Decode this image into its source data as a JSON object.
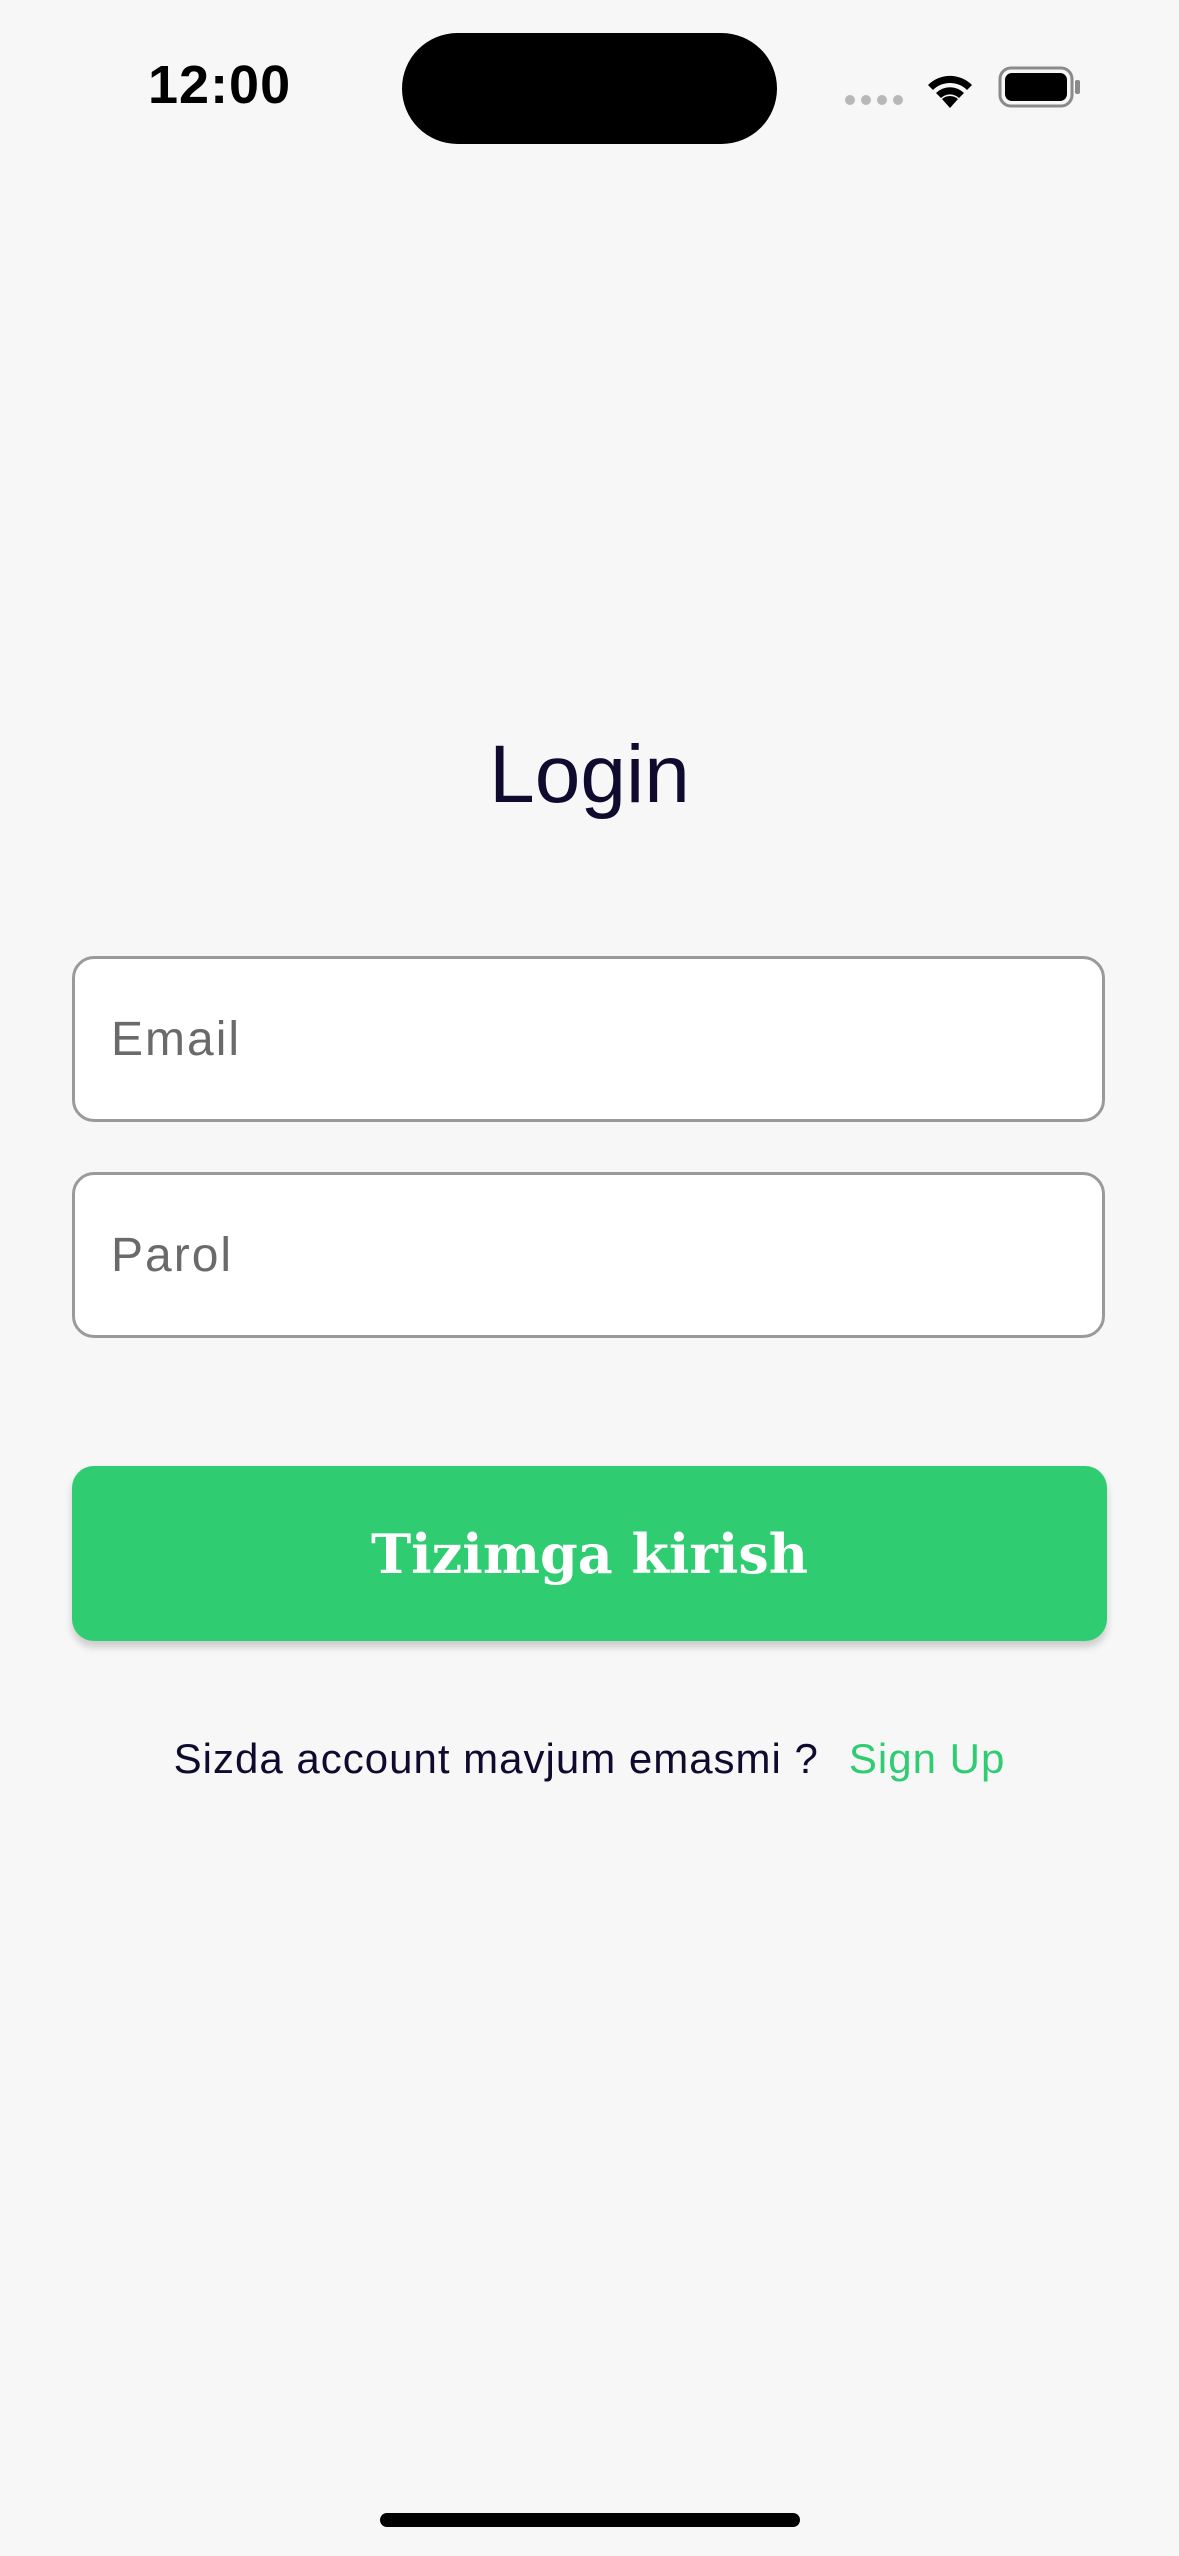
{
  "status_bar": {
    "time": "12:00",
    "icons": [
      "signal-icon",
      "wifi-icon",
      "battery-icon"
    ]
  },
  "login": {
    "title": "Login",
    "email_placeholder": "Email",
    "password_placeholder": "Parol",
    "submit_label": "Tizimga kirish",
    "signup_prompt": "Sizda account mavjum emasmi ?",
    "signup_link": "Sign Up"
  },
  "colors": {
    "accent": "#2fcc72",
    "text": "#0f0b2e",
    "background": "#f7f7f7"
  }
}
